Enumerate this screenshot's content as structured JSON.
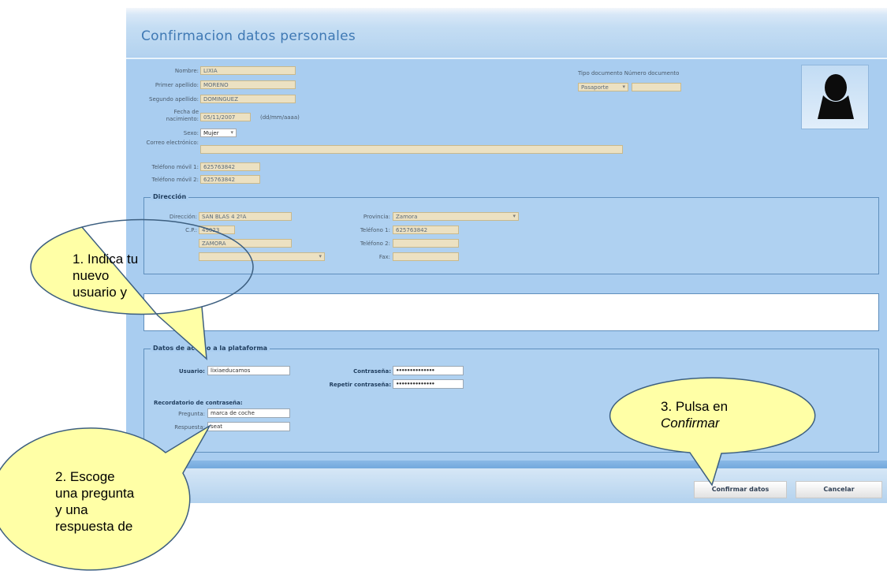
{
  "window": {
    "title": "Confirmacion datos personales"
  },
  "personal": {
    "nombre_label": "Nombre:",
    "nombre": "LIXIA",
    "primer_label": "Primer apellido:",
    "primer": "MORENO",
    "segundo_label": "Segundo apellido:",
    "segundo": "DOMINGUEZ",
    "fecha_label": "Fecha de nacimiento:",
    "fecha": "05/11/2007",
    "fecha_hint": "(dd/mm/aaaa)",
    "sexo_label": "Sexo:",
    "sexo": "Mujer",
    "correo_label": "Correo electrónico:",
    "correo": "",
    "movil1_label": "Teléfono móvil 1:",
    "movil1": "625763842",
    "movil2_label": "Teléfono móvil 2:",
    "movil2": "625763842",
    "tipo_doc_label": "Tipo documento",
    "num_doc_label": "Número documento",
    "tipo_doc": "Pasaporte",
    "num_doc": ""
  },
  "direccion": {
    "legend": "Dirección",
    "direccion_label": "Dirección:",
    "direccion": "SAN BLAS 4 2ºA",
    "cp_label": "C.P.:",
    "cp": "49023",
    "localidad": "ZAMORA",
    "provincia_label": "Provincia:",
    "provincia": "Zamora",
    "tel1_label": "Teléfono 1:",
    "tel1": "625763842",
    "tel2_label": "Teléfono 2:",
    "tel2": "",
    "fax_label": "Fax:",
    "fax": ""
  },
  "acceso": {
    "legend": "Datos de acceso a la plataforma",
    "usuario_label": "Usuario:",
    "usuario": "lixiaeducamos",
    "pass_label": "Contraseña:",
    "pass": "••••••••••••••",
    "repeat_label": "Repetir contraseña:",
    "repeat": "••••••••••••••",
    "recordatorio": "Recordatorio de contraseña:",
    "pregunta_label": "Pregunta:",
    "pregunta": "marca de coche",
    "respuesta_label": "Respuesta:",
    "respuesta": "seat"
  },
  "buttons": {
    "confirm": "Confirmar datos",
    "cancel": "Cancelar"
  },
  "callouts": {
    "c1": [
      "1. Indica tu",
      "nuevo",
      "usuario y"
    ],
    "c2": [
      "2. Escoge",
      "una pregunta",
      "y una",
      "respuesta de"
    ],
    "c3": [
      "3. Pulsa en",
      "Confirmar"
    ]
  },
  "colors": {
    "callout_fill": "#ffffa6",
    "field_fill": "#ece1c2",
    "accent": "#3f79b4"
  }
}
